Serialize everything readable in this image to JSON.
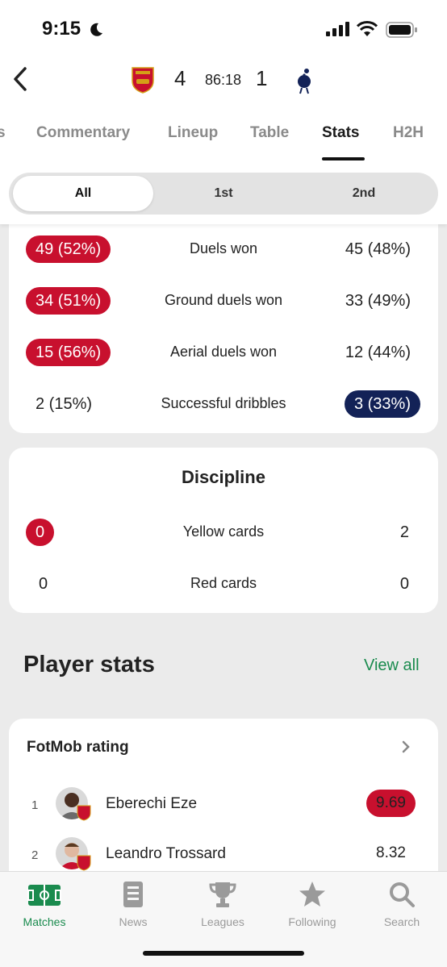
{
  "status": {
    "time": "9:15"
  },
  "header": {
    "home_score": "4",
    "clock": "86:18",
    "away_score": "1"
  },
  "tabs": [
    {
      "label": "s"
    },
    {
      "label": "Commentary"
    },
    {
      "label": "Lineup"
    },
    {
      "label": "Table"
    },
    {
      "label": "Stats"
    },
    {
      "label": "H2H"
    }
  ],
  "active_tab": "Stats",
  "periods": [
    "All",
    "1st",
    "2nd"
  ],
  "active_period": "All",
  "duels": [
    {
      "label": "Duels won",
      "home": "49 (52%)",
      "away": "45 (48%)",
      "leader": "home"
    },
    {
      "label": "Ground duels won",
      "home": "34 (51%)",
      "away": "33 (49%)",
      "leader": "home"
    },
    {
      "label": "Aerial duels won",
      "home": "15 (56%)",
      "away": "12 (44%)",
      "leader": "home"
    },
    {
      "label": "Successful dribbles",
      "home": "2 (15%)",
      "away": "3 (33%)",
      "leader": "away"
    }
  ],
  "discipline": {
    "title": "Discipline",
    "rows": [
      {
        "label": "Yellow cards",
        "home": "0",
        "away": "2",
        "leader": "home"
      },
      {
        "label": "Red cards",
        "home": "0",
        "away": "0",
        "leader": "none"
      }
    ]
  },
  "player_stats": {
    "title": "Player stats",
    "view_all": "View all",
    "rating_title": "FotMob rating",
    "players": [
      {
        "rank": "1",
        "name": "Eberechi Eze",
        "rating": "9.69",
        "highlight": true
      },
      {
        "rank": "2",
        "name": "Leandro Trossard",
        "rating": "8.32",
        "highlight": false
      }
    ]
  },
  "bottom_nav": [
    {
      "label": "Matches",
      "icon": "pitch-icon"
    },
    {
      "label": "News",
      "icon": "news-icon"
    },
    {
      "label": "Leagues",
      "icon": "trophy-icon"
    },
    {
      "label": "Following",
      "icon": "star-icon"
    },
    {
      "label": "Search",
      "icon": "search-icon"
    }
  ],
  "colors": {
    "home": "#c8102e",
    "away": "#132257",
    "accent": "#1a8b4e"
  }
}
